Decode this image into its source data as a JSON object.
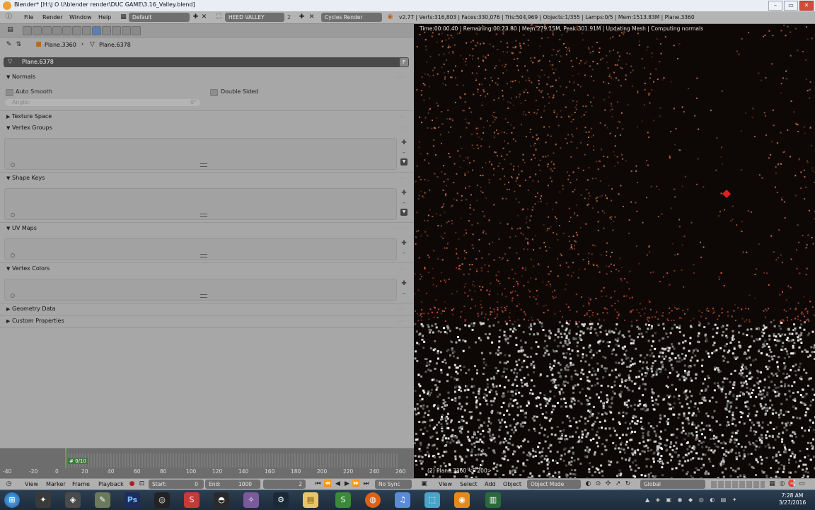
{
  "window": {
    "title": "Blender* [H:\\J O U\\blender render\\DUC GAME\\3.16_Valley.blend]",
    "min_icon": "minimize-icon",
    "max_icon": "maximize-icon",
    "close_icon": "close-icon"
  },
  "header": {
    "menus": [
      "File",
      "Render",
      "Window",
      "Help"
    ],
    "layout": "Default",
    "scene": "HEED VALLEY",
    "scene_users": "2",
    "engine": "Cycles Render",
    "stats": "v2.77 | Verts:316,803 | Faces:330,076 | Tris:504,969 | Objects:1/355 | Lamps:0/5 | Mem:1513.83M | Plane.3360"
  },
  "properties": {
    "breadcrumb": {
      "object": "Plane.3360",
      "mesh": "Plane.6378"
    },
    "mesh_name": "Plane.6378",
    "fake_user": "F",
    "normals": {
      "title": "Normals",
      "auto_smooth": "Auto Smooth",
      "double_sided": "Double Sided",
      "angle_label": "Angle:",
      "angle_value": "0°"
    },
    "panels": {
      "texture_space": "Texture Space",
      "vertex_groups": "Vertex Groups",
      "shape_keys": "Shape Keys",
      "uv_maps": "UV Maps",
      "vertex_colors": "Vertex Colors",
      "geometry_data": "Geometry Data",
      "custom_properties": "Custom Properties"
    }
  },
  "timeline": {
    "ticks": [
      "-40",
      "-20",
      "0",
      "20",
      "40",
      "60",
      "80",
      "100",
      "120",
      "140",
      "160",
      "180",
      "200",
      "220",
      "240",
      "260"
    ],
    "frame_marker": "# 0/10",
    "menus": [
      "View",
      "Marker",
      "Frame",
      "Playback"
    ],
    "start_label": "Start:",
    "start_value": "0",
    "end_label": "End:",
    "end_value": "1000",
    "current": "2",
    "sync": "No Sync"
  },
  "viewport": {
    "status": "Time:00:00.40 | Remaining:00:23.80 | Mem:279.15M, Peak:301.91M | Updating Mesh | Computing normals",
    "object_label": "(2) Plane.3360 <F 200>",
    "menus": [
      "View",
      "Select",
      "Add",
      "Object"
    ],
    "mode": "Object Mode",
    "orientation": "Global"
  },
  "taskbar": {
    "apps": [
      "start-orb",
      "app-icon",
      "app-icon",
      "app-icon",
      "photoshop",
      "app-icon",
      "app-icon",
      "app-icon",
      "app-icon",
      "steam",
      "folder",
      "app-icon",
      "firefox",
      "itunes",
      "app-icon",
      "blender",
      "app-icon"
    ],
    "time": "7:28 AM",
    "date": "3/27/2016"
  },
  "colors": {
    "accent": "#5a7fb0",
    "viewport_bg": "#0d0806",
    "panel_bg": "#a7a7a7"
  }
}
